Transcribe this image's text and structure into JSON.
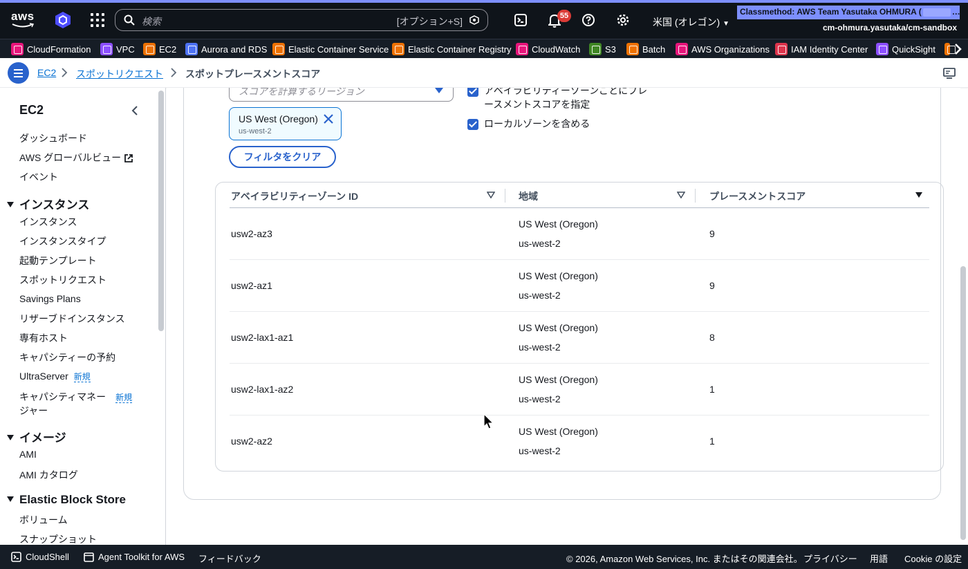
{
  "topbar": {
    "search_placeholder": "検索",
    "search_shortcut": "[オプション+S]",
    "notification_count": "55",
    "region": "米国 (オレゴン)",
    "account_name": "Classmethod: AWS Team Yasutaka OHMURA (",
    "account_masked": "… ",
    "account_role": "cm-ohmura.yasutaka/cm-sandbox"
  },
  "favorites": [
    {
      "label": "CloudFormation",
      "color": "#e7157b"
    },
    {
      "label": "VPC",
      "color": "#8c4fff"
    },
    {
      "label": "EC2",
      "color": "#ed7100"
    },
    {
      "label": "Aurora and RDS",
      "color": "#4d72f3"
    },
    {
      "label": "Elastic Container Service",
      "color": "#ed7100"
    },
    {
      "label": "Elastic Container Registry",
      "color": "#ed7100"
    },
    {
      "label": "CloudWatch",
      "color": "#e7157b"
    },
    {
      "label": "S3",
      "color": "#3f8624"
    },
    {
      "label": "Batch",
      "color": "#ed7100"
    },
    {
      "label": "AWS Organizations",
      "color": "#e7157b"
    },
    {
      "label": "IAM Identity Center",
      "color": "#dd344c"
    },
    {
      "label": "QuickSight",
      "color": "#8c4fff"
    }
  ],
  "breadcrumb": {
    "items": [
      "EC2",
      "スポットリクエスト"
    ],
    "current": "スポットプレースメントスコア"
  },
  "sidebar": {
    "title": "EC2",
    "top_items": [
      "ダッシュボード",
      "AWS グローバルビュー",
      "イベント"
    ],
    "new_badge": "新規",
    "sections": [
      {
        "title": "インスタンス",
        "items": [
          "インスタンス",
          "インスタンスタイプ",
          "起動テンプレート",
          "スポットリクエスト",
          "Savings Plans",
          "リザーブドインスタンス",
          "専有ホスト",
          "キャパシティーの予約",
          "UltraServer",
          "キャパシティマネー",
          "ジャー"
        ]
      },
      {
        "title": "イメージ",
        "items": [
          "AMI",
          "AMI カタログ"
        ]
      },
      {
        "title": "Elastic Block Store",
        "items": [
          "ボリューム",
          "スナップショット"
        ]
      }
    ]
  },
  "form": {
    "region_placeholder": "スコアを計算するリージョン",
    "token_label": "US West (Oregon)",
    "token_sub": "us-west-2",
    "clear_filter": "フィルタをクリア",
    "az_checkbox_line1": "アベイラビリティーゾーンごとにプレ",
    "az_checkbox_line2": "ースメントスコアを指定",
    "local_zone_checkbox": "ローカルゾーンを含める"
  },
  "table": {
    "headers": [
      "アベイラビリティーゾーン ID",
      "地域",
      "プレースメントスコア"
    ],
    "rows": [
      {
        "az": "usw2-az3",
        "region_name": "US West (Oregon)",
        "region_code": "us-west-2",
        "score": "9"
      },
      {
        "az": "usw2-az1",
        "region_name": "US West (Oregon)",
        "region_code": "us-west-2",
        "score": "9"
      },
      {
        "az": "usw2-lax1-az1",
        "region_name": "US West (Oregon)",
        "region_code": "us-west-2",
        "score": "8"
      },
      {
        "az": "usw2-lax1-az2",
        "region_name": "US West (Oregon)",
        "region_code": "us-west-2",
        "score": "1"
      },
      {
        "az": "usw2-az2",
        "region_name": "US West (Oregon)",
        "region_code": "us-west-2",
        "score": "1"
      }
    ]
  },
  "footer": {
    "cloudshell": "CloudShell",
    "agent_toolkit": "Agent Toolkit for AWS",
    "feedback": "フィードバック",
    "copyright": "© 2026, Amazon Web Services, Inc. またはその関連会社。",
    "privacy": "プライバシー",
    "terms": "用語",
    "cookie": "Cookie の設定"
  },
  "colors": {
    "accent": "#2962cc",
    "link": "#0972d3",
    "nav_bg": "#0f141a",
    "account_bar": "#7d8fff",
    "badge": "#db3b36"
  }
}
